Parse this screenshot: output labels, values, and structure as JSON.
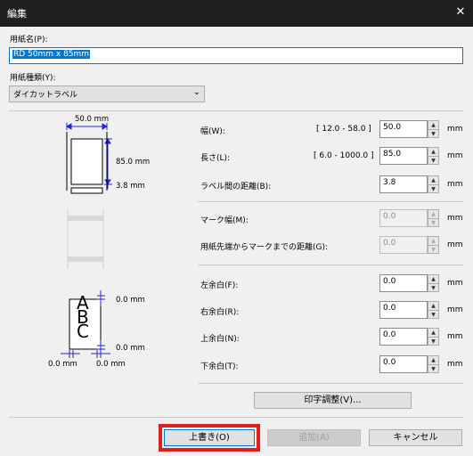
{
  "window": {
    "title": "編集",
    "close_glyph": "✕"
  },
  "paper_name": {
    "label": "用紙名(P):",
    "value": "RD 50mm x 85mm"
  },
  "paper_type": {
    "label": "用紙種類(Y):",
    "value": "ダイカットラベル"
  },
  "diagram1": {
    "width": "50.0 mm",
    "height": "85.0 mm",
    "gap": "3.8 mm"
  },
  "diagram3": {
    "top": "0.0 mm",
    "bottom": "0.0 mm",
    "left": "0.0 mm",
    "right": "0.0 mm",
    "letters": [
      "A",
      "B",
      "C"
    ]
  },
  "fields": {
    "width": {
      "label": "幅(W):",
      "range": "[ 12.0 - 58.0 ]",
      "value": "50.0",
      "unit": "mm"
    },
    "length": {
      "label": "長さ(L):",
      "range": "[ 6.0 - 1000.0 ]",
      "value": "85.0",
      "unit": "mm"
    },
    "gap": {
      "label": "ラベル間の距離(B):",
      "value": "3.8",
      "unit": "mm"
    },
    "mark_width": {
      "label": "マーク幅(M):",
      "value": "0.0",
      "unit": "mm"
    },
    "mark_distance": {
      "label": "用紙先端からマークまでの距離(G):",
      "value": "0.0",
      "unit": "mm"
    },
    "left_margin": {
      "label": "左余白(F):",
      "value": "0.0",
      "unit": "mm"
    },
    "right_margin": {
      "label": "右余白(R):",
      "value": "0.0",
      "unit": "mm"
    },
    "top_margin": {
      "label": "上余白(N):",
      "value": "0.0",
      "unit": "mm"
    },
    "bottom_margin": {
      "label": "下余白(T):",
      "value": "0.0",
      "unit": "mm"
    }
  },
  "buttons": {
    "print_adjust": "印字調整(V)...",
    "overwrite": "上書き(O)",
    "add": "追加(A)",
    "cancel": "キャンセル"
  },
  "colors": {
    "accent": "#0078d7",
    "highlight": "#e21e1e",
    "dimension_blue": "#2323e6"
  }
}
